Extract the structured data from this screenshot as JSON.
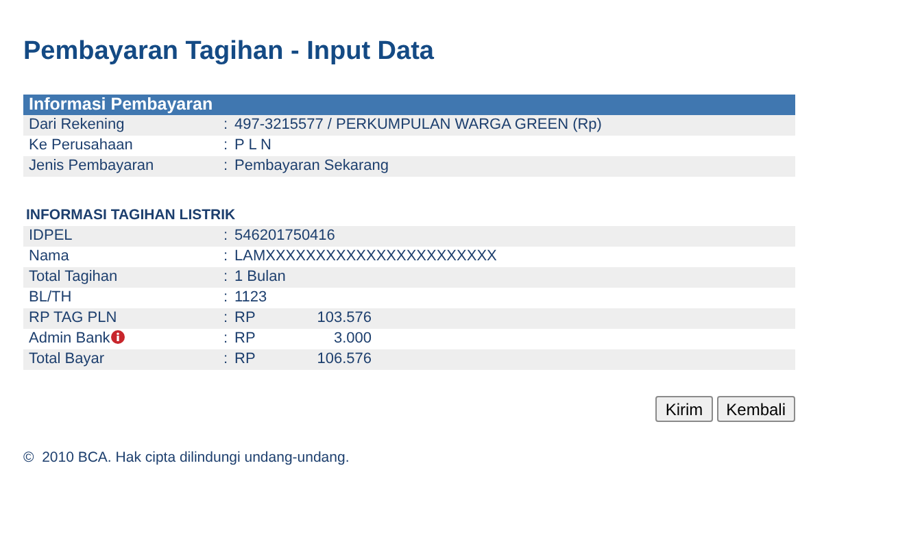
{
  "title": "Pembayaran Tagihan - Input Data",
  "payment_info": {
    "heading": "Informasi Pembayaran",
    "rows": [
      {
        "label": "Dari Rekening",
        "separator": ":",
        "value": "497-3215577 / PERKUMPULAN WARGA GREEN (Rp)"
      },
      {
        "label": "Ke Perusahaan",
        "separator": ":",
        "value": "P L N"
      },
      {
        "label": "Jenis Pembayaran",
        "separator": ":",
        "value": "Pembayaran Sekarang"
      }
    ]
  },
  "bill_info": {
    "heading": "INFORMASI TAGIHAN LISTRIK",
    "rows": [
      {
        "kind": "text",
        "label": "IDPEL",
        "separator": ":",
        "value": "546201750416"
      },
      {
        "kind": "text",
        "label": "Nama",
        "separator": ":",
        "value": "LAMXXXXXXXXXXXXXXXXXXXXXXX"
      },
      {
        "kind": "text",
        "label": "Total Tagihan",
        "separator": ":",
        "value": "1 Bulan"
      },
      {
        "kind": "text",
        "label": "BL/TH",
        "separator": ":",
        "value": "1123"
      },
      {
        "kind": "amount",
        "label": "RP TAG PLN",
        "separator": ":",
        "currency": "RP",
        "value": "103.576"
      },
      {
        "kind": "amount",
        "label": "Admin Bank",
        "info": true,
        "separator": ":",
        "currency": "RP",
        "value": "3.000"
      },
      {
        "kind": "amount",
        "label": "Total Bayar",
        "separator": ":",
        "currency": "RP",
        "value": "106.576"
      }
    ]
  },
  "buttons": [
    "Kirim",
    "Kembali"
  ],
  "footer": "©  2010 BCA. Hak cipta dilindungi undang-undang."
}
